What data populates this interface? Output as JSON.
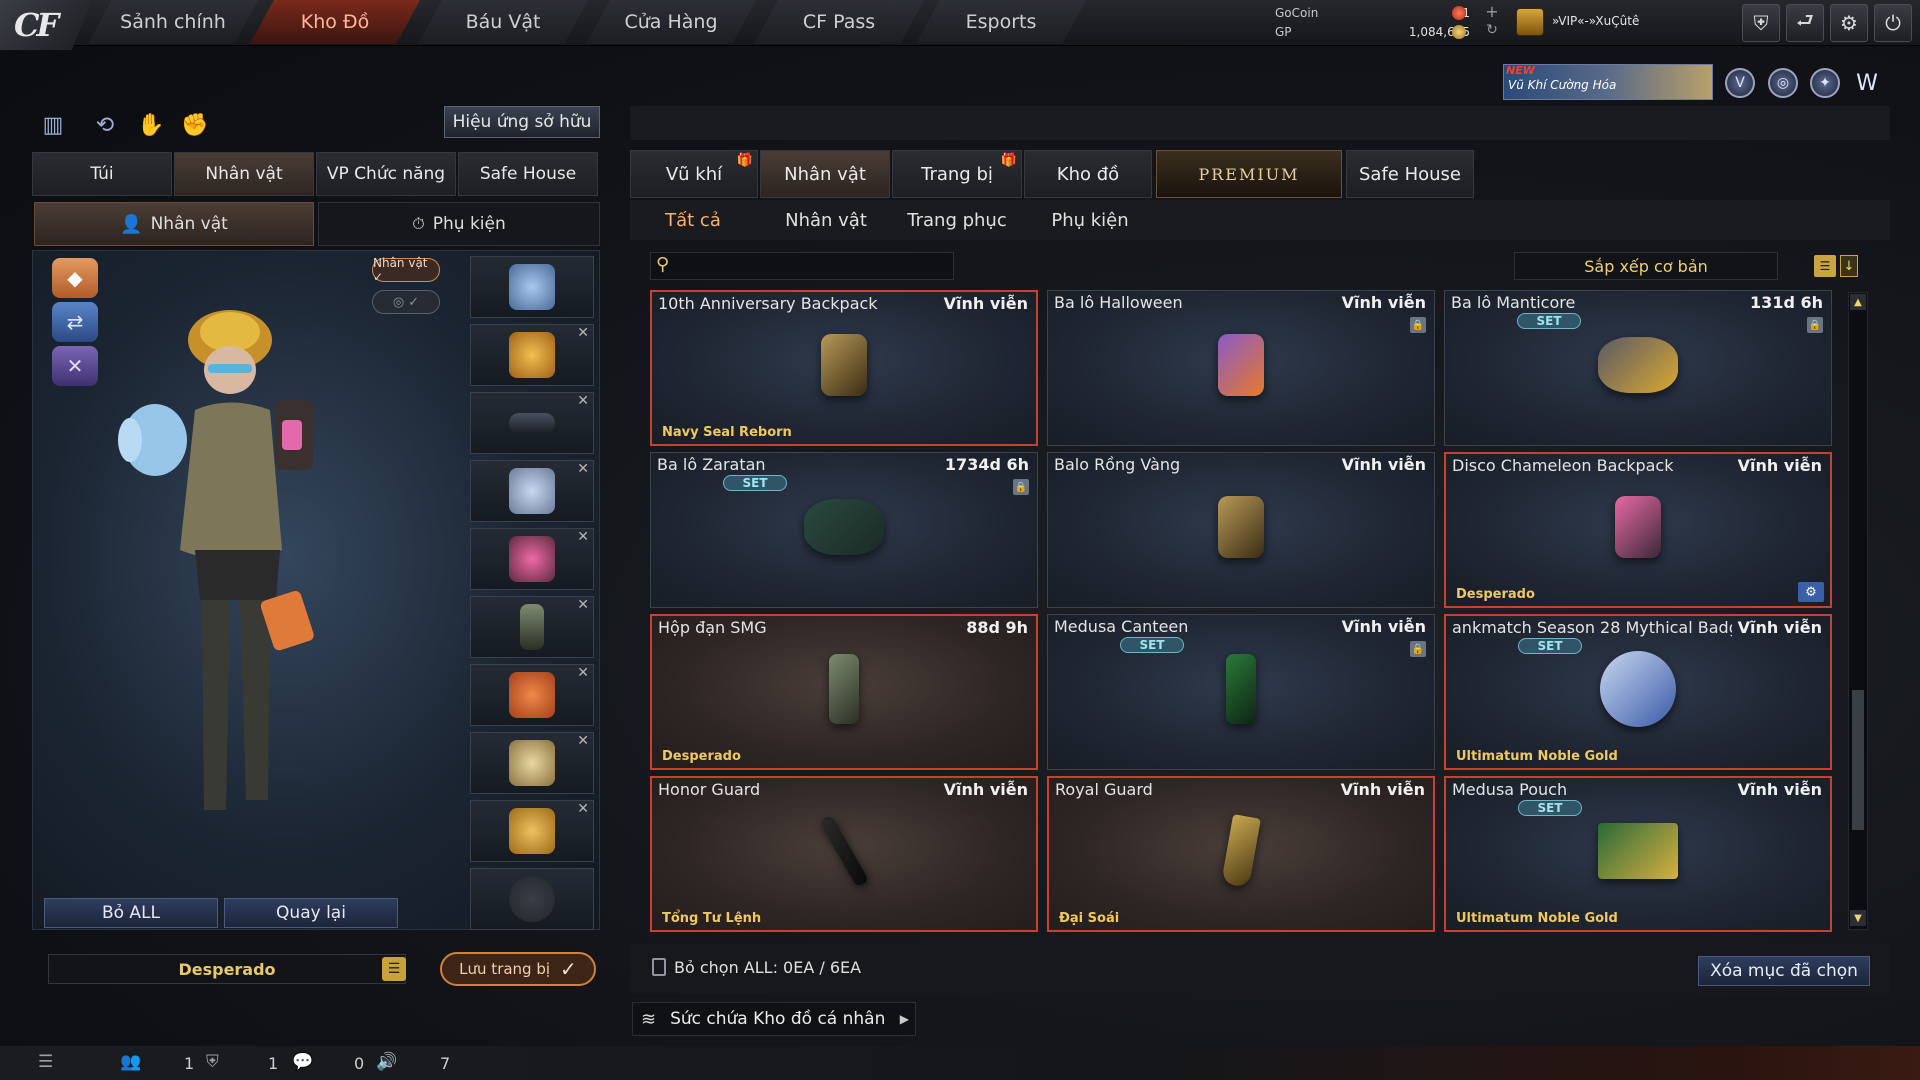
{
  "logo": {
    "text": "CF"
  },
  "nav": {
    "tabs": [
      "Sảnh chính",
      "Kho Đồ",
      "Báu Vật",
      "Cửa Hàng",
      "CF Pass",
      "Esports"
    ],
    "active": 1
  },
  "currency": {
    "gocoin_label": "GoCoin",
    "gp_label": "GP",
    "gocoin_value": "1",
    "gp_value": "1,084,615",
    "plus_icon": "plus-icon",
    "refresh_icon": "refresh-icon"
  },
  "player": {
    "name": "»VIP«-»XuÇûtê"
  },
  "system_buttons": [
    "shield-icon",
    "exit-icon",
    "gear-icon",
    "power-icon"
  ],
  "event": {
    "new_label": "NEW",
    "banner_text": "Vũ Khí Cường Hóa"
  },
  "left": {
    "owned_effects_button": "Hiệu ứng sở hữu",
    "tabs": [
      "Túi",
      "Nhân vật",
      "VP Chức năng",
      "Safe House"
    ],
    "active_tab": 1,
    "sub_tabs": [
      "Nhân vật",
      "Phụ kiện"
    ],
    "tag_character": "Nhân vật ✓",
    "tag_hidden": "◎ ✓",
    "remove_all_button": "Bỏ ALL",
    "back_button": "Quay lại",
    "preset_name": "Desperado",
    "save_outfit_button": "Lưu trang bị"
  },
  "right": {
    "tabs": [
      "Vũ khí",
      "Nhân vật",
      "Trang bị",
      "Kho đồ",
      "PREMIUM",
      "Safe House"
    ],
    "active_tab": 1,
    "filter_tabs": [
      "Tất cả",
      "Nhân vật",
      "Trang phục",
      "Phụ kiện"
    ],
    "active_filter": 0,
    "search_placeholder": "",
    "sort_label": "Sắp xếp cơ bản",
    "items": [
      {
        "name": "10th Anniversary Backpack",
        "duration": "Vĩnh viễn",
        "set": false,
        "lock": false,
        "owner": "Navy Seal Reborn",
        "selected": true,
        "tone": "blue"
      },
      {
        "name": "Ba lô Halloween",
        "duration": "Vĩnh viễn",
        "set": false,
        "lock": true,
        "owner": "",
        "selected": false,
        "tone": "blue"
      },
      {
        "name": "Ba lô Manticore",
        "duration": "131d 6h",
        "set": true,
        "lock": true,
        "owner": "",
        "selected": false,
        "tone": "blue"
      },
      {
        "name": "Ba lô Zaratan",
        "duration": "1734d 6h",
        "set": true,
        "lock": true,
        "owner": "",
        "selected": false,
        "tone": "blue"
      },
      {
        "name": "Balo Rồng Vàng",
        "duration": "Vĩnh viễn",
        "set": false,
        "lock": false,
        "owner": "",
        "selected": false,
        "tone": "blue"
      },
      {
        "name": "Disco Chameleon Backpack",
        "duration": "Vĩnh viễn",
        "set": false,
        "lock": false,
        "owner": "Desperado",
        "selected": true,
        "tone": "blue",
        "gear": true
      },
      {
        "name": "Hộp đạn SMG",
        "duration": "88d 9h",
        "set": false,
        "lock": false,
        "owner": "Desperado",
        "selected": true,
        "tone": "brown"
      },
      {
        "name": "Medusa Canteen",
        "duration": "Vĩnh viễn",
        "set": true,
        "lock": true,
        "owner": "",
        "selected": false,
        "tone": "blue"
      },
      {
        "name": "ankmatch Season 28 Mythical Badg",
        "duration": "Vĩnh viễn",
        "set": true,
        "lock": false,
        "owner": "Ultimatum Noble Gold",
        "selected": true,
        "tone": "blue"
      },
      {
        "name": "Honor Guard",
        "duration": "Vĩnh viễn",
        "set": false,
        "lock": false,
        "owner": "Tổng Tư Lệnh",
        "selected": true,
        "tone": "brown"
      },
      {
        "name": "Royal Guard",
        "duration": "Vĩnh viễn",
        "set": false,
        "lock": false,
        "owner": "Đại Soái",
        "selected": true,
        "tone": "brown"
      },
      {
        "name": "Medusa Pouch",
        "duration": "Vĩnh viễn",
        "set": true,
        "lock": false,
        "owner": "Ultimatum Noble Gold",
        "selected": true,
        "tone": "blue"
      }
    ],
    "set_label": "SET",
    "deselect_label": "Bỏ chọn ALL: 0EA / 6EA",
    "delete_selected_button": "Xóa mục đã chọn",
    "capacity_label": "Sức chứa Kho đồ cá nhân"
  },
  "statusbar": {
    "values": [
      "1",
      "1",
      "0",
      "7"
    ]
  },
  "colors": {
    "accent": "#c8402e",
    "gold": "#f0c860",
    "set_badge": "#6fb5c8"
  }
}
